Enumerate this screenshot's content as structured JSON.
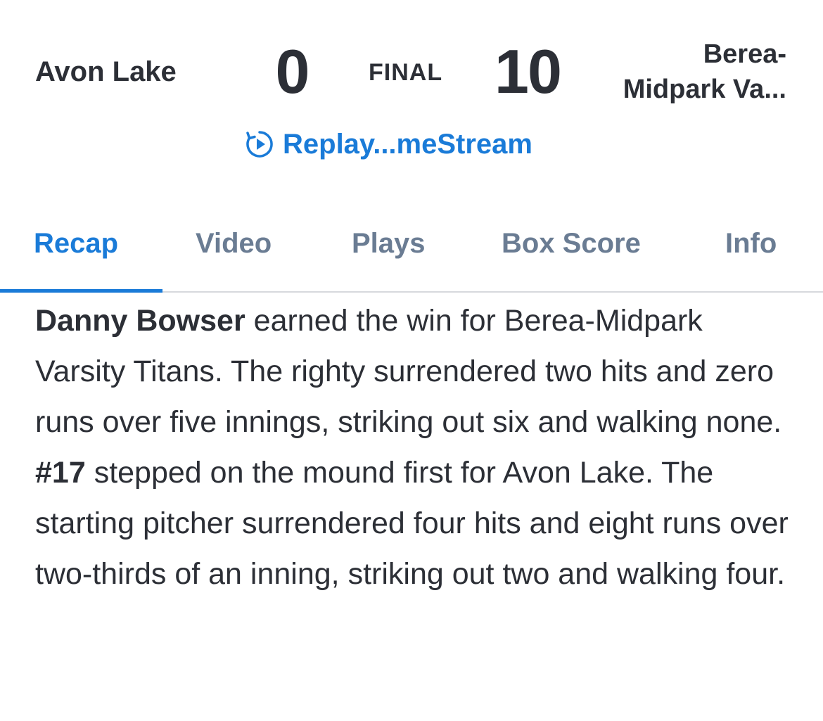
{
  "scoreboard": {
    "away_team": "Avon Lake",
    "away_score": "0",
    "status": "FINAL",
    "home_score": "10",
    "home_team_line1": "Berea-",
    "home_team_line2": "Midpark Va..."
  },
  "replay": {
    "label": "Replay...meStream",
    "icon": "replay-play-icon",
    "color": "#1a7bd8"
  },
  "tabs": [
    {
      "label": "Recap",
      "active": true
    },
    {
      "label": "Video",
      "active": false
    },
    {
      "label": "Plays",
      "active": false
    },
    {
      "label": "Box Score",
      "active": false
    },
    {
      "label": "Info",
      "active": false
    }
  ],
  "recap": {
    "p1_bold": "Danny Bowser",
    "p1_text": " earned the win for Berea-Midpark Varsity Titans. The righty surrendered two hits and zero runs over five innings, striking out six and walking none.",
    "p2_bold": "#17",
    "p2_text": " stepped on the mound first for Avon Lake. The starting pitcher surrendered four hits and eight runs over two-thirds of an inning, striking out two and walking four."
  },
  "colors": {
    "accent": "#1a7bd8",
    "text": "#2c2f36",
    "tab_inactive": "#6a7c93"
  }
}
